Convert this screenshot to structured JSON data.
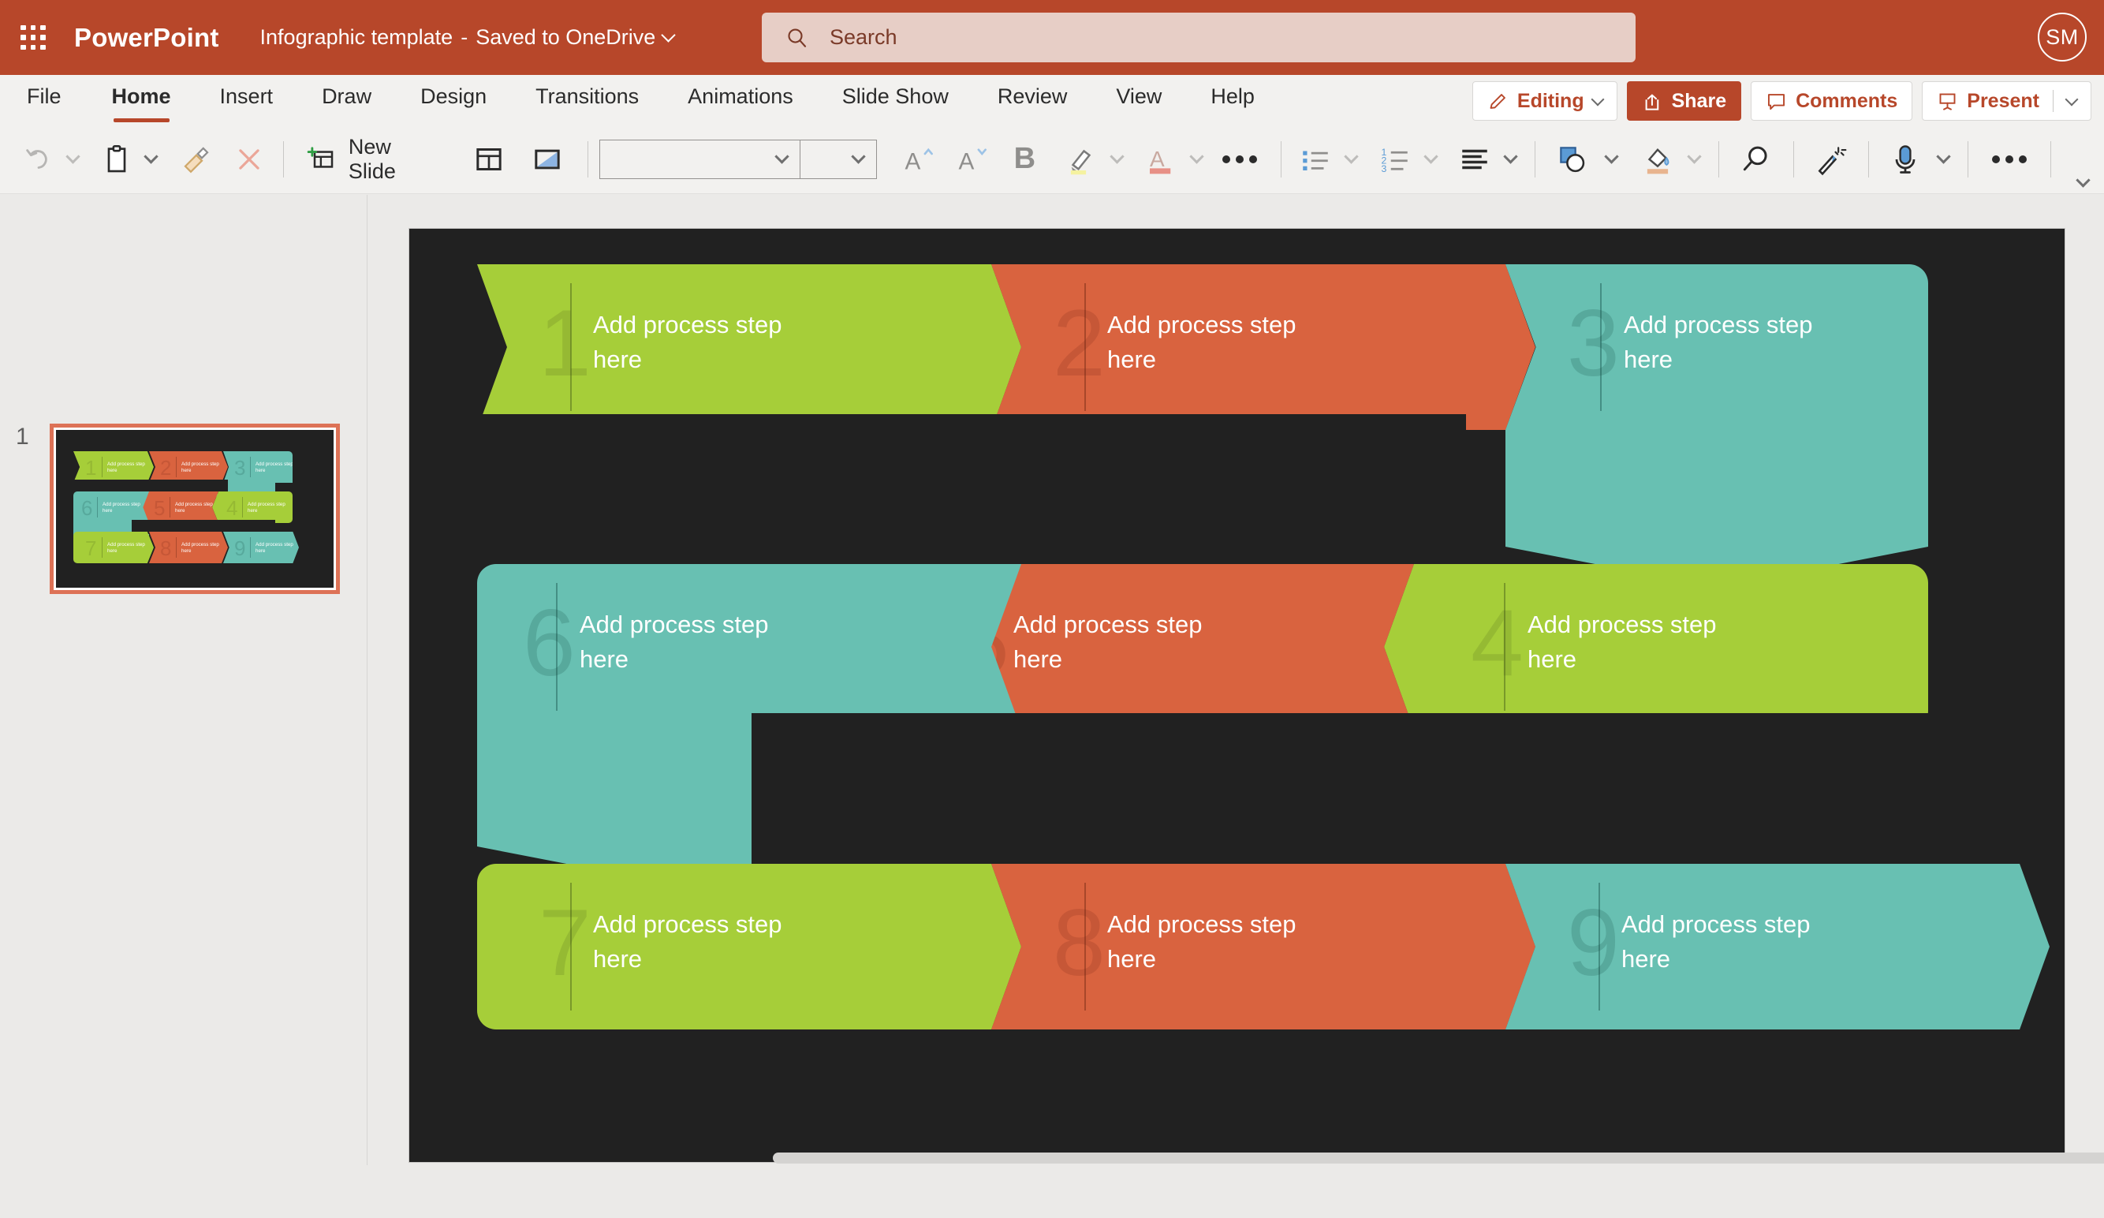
{
  "titlebar": {
    "app_name": "PowerPoint",
    "doc_title": "Infographic template",
    "doc_separator": "-",
    "doc_status": "Saved to OneDrive",
    "search_placeholder": "Search",
    "avatar_initials": "SM",
    "brand_color": "#b7472a"
  },
  "ribbon": {
    "tabs": [
      {
        "label": "File",
        "active": false
      },
      {
        "label": "Home",
        "active": true
      },
      {
        "label": "Insert",
        "active": false
      },
      {
        "label": "Draw",
        "active": false
      },
      {
        "label": "Design",
        "active": false
      },
      {
        "label": "Transitions",
        "active": false
      },
      {
        "label": "Animations",
        "active": false
      },
      {
        "label": "Slide Show",
        "active": false
      },
      {
        "label": "Review",
        "active": false
      },
      {
        "label": "View",
        "active": false
      },
      {
        "label": "Help",
        "active": false
      }
    ],
    "editing_label": "Editing",
    "share_label": "Share",
    "comments_label": "Comments",
    "present_label": "Present"
  },
  "toolbar": {
    "new_slide_label": "New Slide",
    "font_name_value": "",
    "font_size_value": "",
    "icons": [
      "undo-icon",
      "paste-icon",
      "format-painter-icon",
      "clear-formatting-icon",
      "new-slide-icon",
      "layout-icon",
      "reset-icon",
      "grow-font-icon",
      "shrink-font-icon",
      "bold-icon",
      "text-highlight-icon",
      "font-color-icon",
      "more-font-options-icon",
      "bullets-icon",
      "numbering-icon",
      "align-icon",
      "shapes-icon",
      "shape-fill-icon",
      "find-icon",
      "designer-icon",
      "dictate-icon",
      "more-options-icon"
    ]
  },
  "slide_panel": {
    "slide_number": "1"
  },
  "slide": {
    "background_color": "#212121",
    "palette": {
      "green": "#a6ce39",
      "orange": "#d9633f",
      "teal": "#68c0b2",
      "green_num": "#7b9a2b",
      "orange_num": "#a8452a",
      "teal_num": "#3e857a"
    },
    "steps": [
      {
        "number": "1",
        "text": "Add process step here",
        "color": "green"
      },
      {
        "number": "2",
        "text": "Add process step here",
        "color": "orange"
      },
      {
        "number": "3",
        "text": "Add process step here",
        "color": "teal"
      },
      {
        "number": "4",
        "text": "Add process step here",
        "color": "green"
      },
      {
        "number": "5",
        "text": "Add process step here",
        "color": "orange"
      },
      {
        "number": "6",
        "text": "Add process step here",
        "color": "teal"
      },
      {
        "number": "7",
        "text": "Add process step here",
        "color": "green"
      },
      {
        "number": "8",
        "text": "Add process step here",
        "color": "orange"
      },
      {
        "number": "9",
        "text": "Add process step here",
        "color": "teal"
      }
    ]
  }
}
